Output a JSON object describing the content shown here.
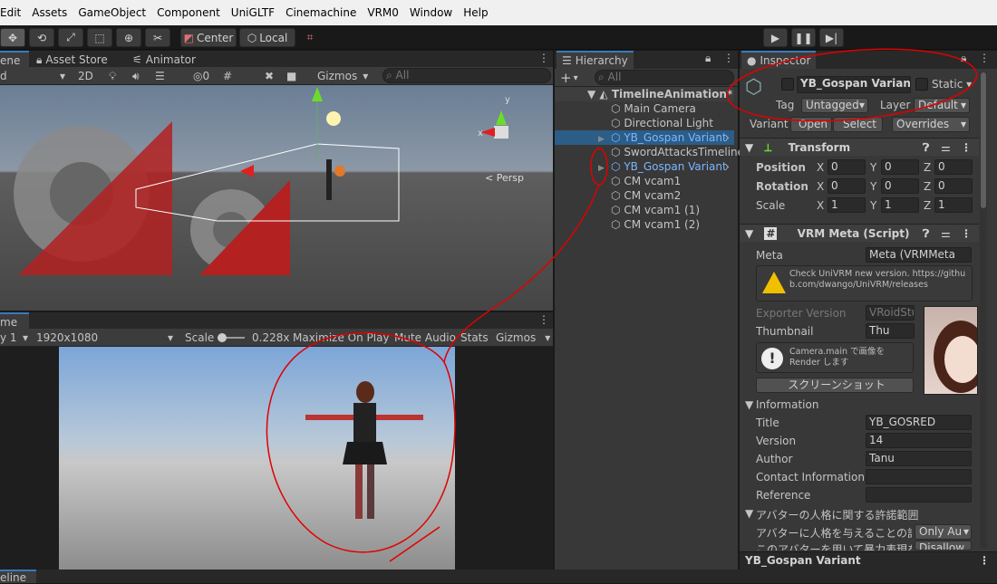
{
  "menu": [
    "Edit",
    "Assets",
    "GameObject",
    "Component",
    "UniGLTF",
    "Cinemachine",
    "VRM0",
    "Window",
    "Help"
  ],
  "toolbar": {
    "center_label": "Center",
    "local_label": "Local"
  },
  "colors": {
    "accent": "#3a79bb",
    "selection": "#2c5d87",
    "prefab_blue": "#7cb6ff",
    "annotation_red": "#e00000"
  },
  "scene": {
    "tabs": [
      "ene",
      "Asset Store",
      "Animator"
    ],
    "draw_mode": "d",
    "mode2d": "2D",
    "hidden_count": "0",
    "gizmos_label": "Gizmos",
    "search_placeholder": "All",
    "persp_label": "< Persp",
    "axis_y": "y",
    "axis_x": "x"
  },
  "game": {
    "tab": "me",
    "display": "y 1",
    "resolution": "1920x1080",
    "scale_label": "Scale",
    "scale_value": "0.228x",
    "maximize": "Maximize On Play",
    "mute": "Mute Audio",
    "stats": "Stats",
    "gizmos": "Gizmos"
  },
  "hierarchy": {
    "tab": "Hierarchy",
    "add": "+",
    "search_placeholder": "All",
    "scene_name": "TimelineAnimation*",
    "items": [
      {
        "label": "Main Camera",
        "selected": false,
        "prefab": false
      },
      {
        "label": "Directional Light",
        "selected": false,
        "prefab": false
      },
      {
        "label": "YB_Gospan Variant",
        "selected": true,
        "prefab": true
      },
      {
        "label": "SwordAttacksTimeline",
        "selected": false,
        "prefab": false
      },
      {
        "label": "YB_Gospan Variant",
        "selected": false,
        "prefab": true
      },
      {
        "label": "CM vcam1",
        "selected": false,
        "prefab": false
      },
      {
        "label": "CM vcam2",
        "selected": false,
        "prefab": false
      },
      {
        "label": "CM vcam1 (1)",
        "selected": false,
        "prefab": false
      },
      {
        "label": "CM vcam1 (2)",
        "selected": false,
        "prefab": false
      }
    ]
  },
  "inspector": {
    "tab": "Inspector",
    "object_name": "YB_Gospan Variant",
    "static_label": "Static",
    "tag_label": "Tag",
    "tag_value": "Untagged",
    "layer_label": "Layer",
    "layer_value": "Default",
    "variant_label": "Variant",
    "open_label": "Open",
    "select_label": "Select",
    "overrides_label": "Overrides",
    "transform": {
      "title": "Transform",
      "rows": [
        {
          "label": "Position",
          "x": "0",
          "y": "0",
          "z": "0"
        },
        {
          "label": "Rotation",
          "x": "0",
          "y": "0",
          "z": "0"
        },
        {
          "label": "Scale",
          "x": "1",
          "y": "1",
          "z": "1"
        }
      ]
    },
    "vrm_meta": {
      "title": "VRM Meta (Script)",
      "meta_label": "Meta",
      "meta_value": "Meta (VRMMeta",
      "warning": "Check UniVRM new version. https://github.com/dwango/UniVRM/releases",
      "exporter_label": "Exporter Version",
      "exporter_value": "VRoidStu",
      "thumbnail_label": "Thumbnail",
      "thumbnail_value": "Thu",
      "info_text": "Camera.main で画像を Render します",
      "screenshot_button": "スクリーンショット",
      "information_label": "Information",
      "fields": [
        {
          "label": "Title",
          "value": "YB_GOSRED"
        },
        {
          "label": "Version",
          "value": "14"
        },
        {
          "label": "Author",
          "value": "Tanu"
        },
        {
          "label": "Contact Information",
          "value": ""
        },
        {
          "label": "Reference",
          "value": ""
        }
      ],
      "permission_header": "アバターの人格に関する許諾範囲",
      "perm1_label": "アバターに人格を与えることの許",
      "perm1_value": "Only Au",
      "perm2_label": "このアバターを用いて暴力表現を",
      "perm2_value": "Disallow"
    },
    "footer": "YB_Gospan Variant"
  },
  "bottom_tab": "eline"
}
